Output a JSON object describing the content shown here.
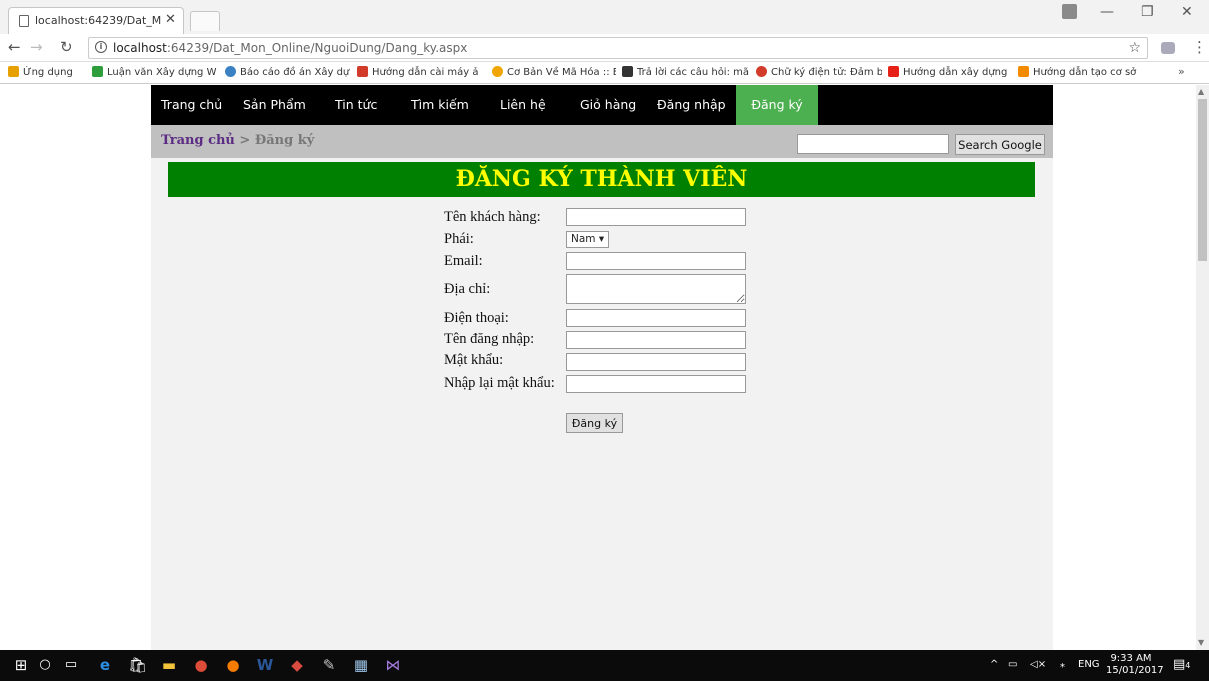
{
  "browser": {
    "tab_title": "localhost:64239/Dat_Mo",
    "url_host": "localhost",
    "url_path": ":64239/Dat_Mon_Online/NguoiDung/Dang_ky.aspx",
    "bookmarks": [
      {
        "label": "Ứng dụng",
        "color": "#e6a100"
      },
      {
        "label": "Luận văn Xây dựng W",
        "color": "#2e9e3c"
      },
      {
        "label": "Báo cáo đồ án Xây dự",
        "color": "#3b82c4"
      },
      {
        "label": "Hướng dẫn cài máy ả",
        "color": "#d23b2a"
      },
      {
        "label": "Cơ Bản Về Mã Hóa :: E",
        "color": "#f0a500"
      },
      {
        "label": "Trả lời các câu hỏi: mã",
        "color": "#333333"
      },
      {
        "label": "Chữ ký điện tử: Đảm b",
        "color": "#d23b2a"
      },
      {
        "label": "Hướng dẫn xây dựng",
        "color": "#e62117"
      },
      {
        "label": "Hướng dẫn tạo cơ sở",
        "color": "#f28b00"
      }
    ],
    "bookmark_more": "»"
  },
  "nav": {
    "items": [
      {
        "label": "Trang chủ"
      },
      {
        "label": "Sản Phẩm"
      },
      {
        "label": "Tin tức"
      },
      {
        "label": "Tìm kiếm"
      },
      {
        "label": "Liên hệ"
      },
      {
        "label": "Giỏ hàng"
      },
      {
        "label": "Đăng nhập"
      },
      {
        "label": "Đăng ký",
        "active": true
      }
    ],
    "active_color": "#4caf50"
  },
  "breadcrumb": {
    "home": "Trang chủ",
    "separator": ">",
    "current": "Đăng ký"
  },
  "search": {
    "value": "",
    "button_label": "Search Google"
  },
  "form": {
    "title": "ĐĂNG KÝ THÀNH VIÊN",
    "title_bg": "#008000",
    "title_color": "#ffff00",
    "labels": {
      "customer_name": "Tên khách hàng:",
      "gender": "Phái:",
      "email": "Email:",
      "address": "Địa chỉ:",
      "phone": "Điện thoại:",
      "username": "Tên đăng nhập:",
      "password": "Mật khẩu:",
      "confirm_password": "Nhập lại mật khẩu:"
    },
    "gender_selected": "Nam",
    "submit_label": "Đăng ký"
  },
  "taskbar": {
    "lang": "ENG",
    "time": "9:33 AM",
    "date": "15/01/2017",
    "notifications": "4"
  }
}
